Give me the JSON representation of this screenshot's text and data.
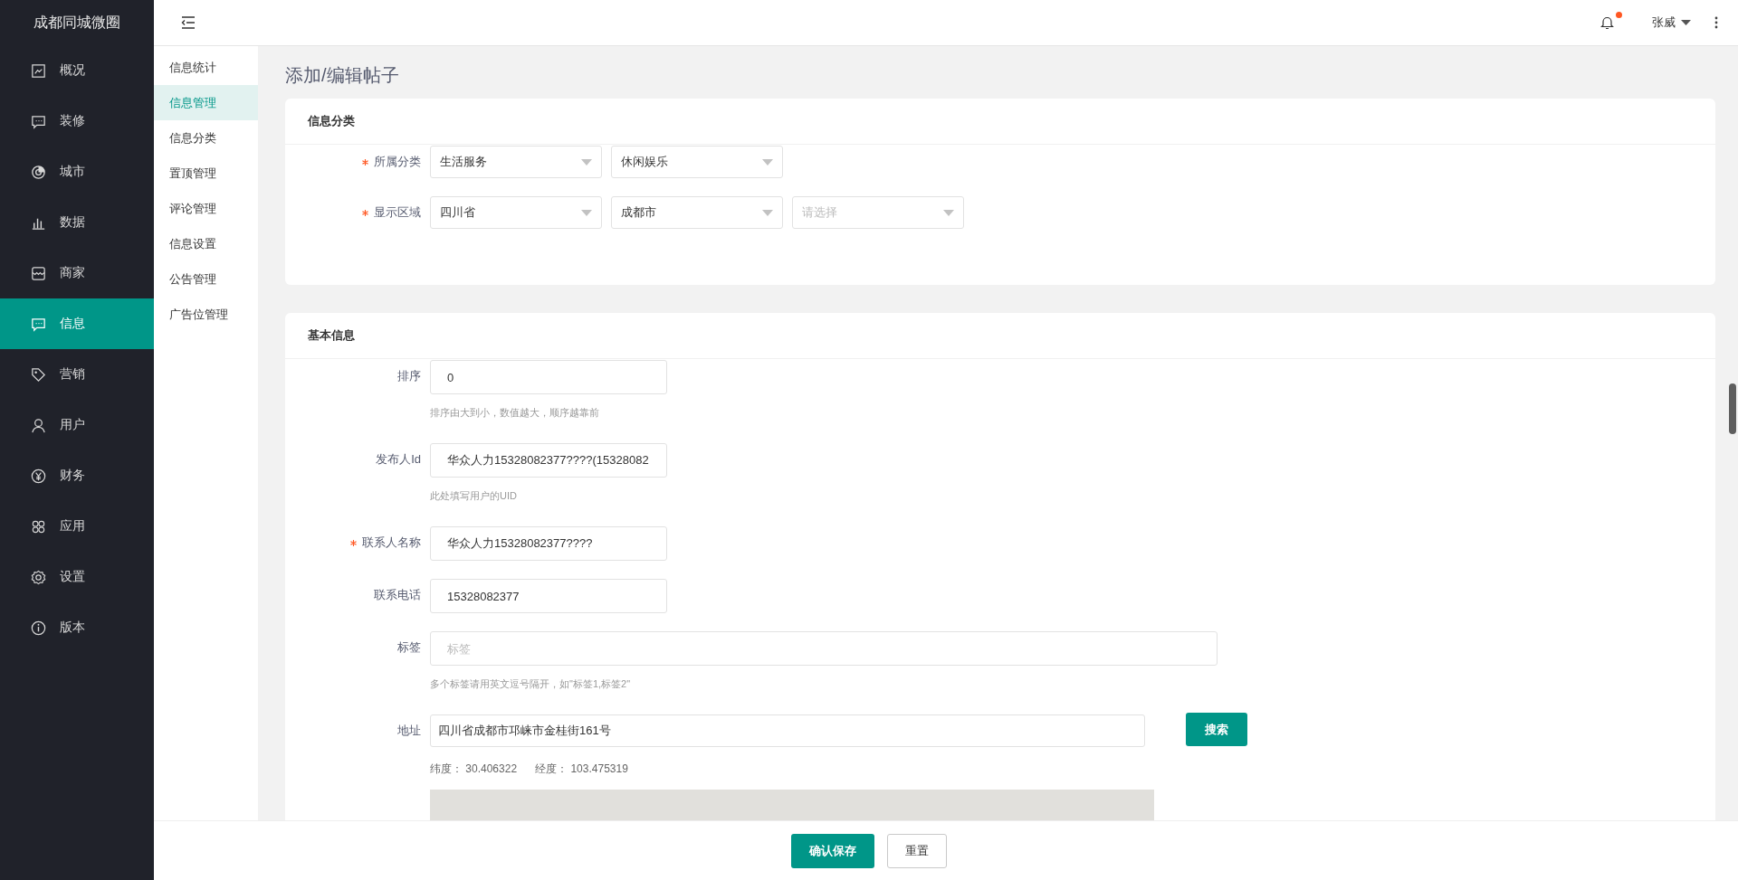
{
  "app": {
    "title": "成都同城微圈"
  },
  "nav": [
    {
      "label": "概况",
      "selected": false
    },
    {
      "label": "装修",
      "selected": false
    },
    {
      "label": "城市",
      "selected": false
    },
    {
      "label": "数据",
      "selected": false
    },
    {
      "label": "商家",
      "selected": false
    },
    {
      "label": "信息",
      "selected": true
    },
    {
      "label": "营销",
      "selected": false
    },
    {
      "label": "用户",
      "selected": false
    },
    {
      "label": "财务",
      "selected": false
    },
    {
      "label": "应用",
      "selected": false
    },
    {
      "label": "设置",
      "selected": false
    },
    {
      "label": "版本",
      "selected": false
    }
  ],
  "submenu": [
    {
      "label": "信息统计",
      "selected": false
    },
    {
      "label": "信息管理",
      "selected": true
    },
    {
      "label": "信息分类",
      "selected": false
    },
    {
      "label": "置顶管理",
      "selected": false
    },
    {
      "label": "评论管理",
      "selected": false
    },
    {
      "label": "信息设置",
      "selected": false
    },
    {
      "label": "公告管理",
      "selected": false
    },
    {
      "label": "广告位管理",
      "selected": false
    }
  ],
  "topbar": {
    "notification_dot": true,
    "user": "张威"
  },
  "page_title": "添加/编辑帖子",
  "sections": [
    {
      "title": "信息分类",
      "rows": [
        {
          "kind": "selects",
          "label": "所属分类",
          "required": true,
          "selects": [
            {
              "value": "生活服务"
            },
            {
              "value": "休闲娱乐"
            }
          ]
        },
        {
          "kind": "selects",
          "label": "显示区域",
          "required": true,
          "selects": [
            {
              "value": "四川省"
            },
            {
              "value": "成都市"
            },
            {
              "placeholder": "请选择"
            }
          ]
        }
      ]
    },
    {
      "title": "基本信息",
      "rows": [
        {
          "kind": "input",
          "label": "排序",
          "required": false,
          "value": "0",
          "hint": "排序由大到小，数值越大，顺序越靠前"
        },
        {
          "kind": "input",
          "label": "发布人Id",
          "required": false,
          "value": "华众人力15328082377????(15328082",
          "hint": "此处填写用户的UID"
        },
        {
          "kind": "input",
          "label": "联系人名称",
          "required": true,
          "value": "华众人力15328082377????"
        },
        {
          "kind": "input",
          "label": "联系电话",
          "required": false,
          "value": "15328082377"
        },
        {
          "kind": "wide-input",
          "label": "标签",
          "required": false,
          "placeholder": "标签",
          "hint": "多个标签请用英文逗号隔开，如\"标签1,标签2\""
        },
        {
          "kind": "address",
          "label": "地址",
          "required": false,
          "value": "四川省成都市邛崃市金桂街161号",
          "button": "搜索",
          "lat_label": "纬度：",
          "lat": "30.406322",
          "lng_label": "经度：",
          "lng": "103.475319"
        }
      ]
    }
  ],
  "footer": {
    "buttons": [
      {
        "label": "确认保存"
      },
      {
        "label": "重置"
      }
    ]
  }
}
